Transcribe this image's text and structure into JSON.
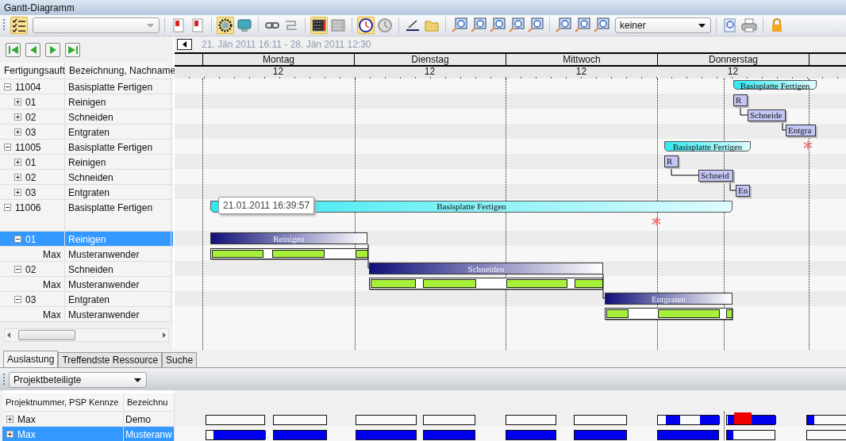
{
  "window": {
    "title": "Gantt-Diagramm"
  },
  "toolbar": [
    [
      {
        "kind": "button",
        "pressed": true
      },
      {
        "kind": "combo"
      }
    ],
    [
      {
        "kind": "button",
        "pressed": false
      },
      {
        "kind": "button",
        "pressed": false
      }
    ],
    [
      {
        "kind": "button",
        "pressed": true
      },
      {
        "kind": "button",
        "pressed": false
      }
    ],
    [
      {
        "kind": "button",
        "pressed": false
      },
      {
        "kind": "button",
        "pressed": false
      }
    ],
    [
      {
        "kind": "button",
        "pressed": true
      },
      {
        "kind": "button",
        "pressed": false
      }
    ],
    [
      {
        "kind": "button",
        "pressed": true
      },
      {
        "kind": "button",
        "pressed": false
      }
    ],
    [
      {
        "kind": "button",
        "pressed": false
      },
      {
        "kind": "button",
        "pressed": false
      }
    ],
    [
      {
        "kind": "button",
        "pressed": false
      },
      {
        "kind": "button",
        "pressed": false
      },
      {
        "kind": "button",
        "pressed": false
      },
      {
        "kind": "button",
        "pressed": false
      },
      {
        "kind": "button",
        "pressed": false
      }
    ],
    [
      {
        "kind": "button",
        "pressed": false
      },
      {
        "kind": "button",
        "pressed": false
      },
      {
        "kind": "button",
        "pressed": false
      },
      {
        "kind": "combo",
        "value": "keiner"
      }
    ],
    [
      {
        "kind": "button",
        "pressed": false
      },
      {
        "kind": "button",
        "pressed": false
      }
    ],
    [
      {
        "kind": "button",
        "pressed": false
      }
    ]
  ],
  "tree": {
    "columns": [
      "Fertigungsauft",
      "Bezeichnung, Nachname"
    ]
  },
  "orders": [
    {
      "id": "11004",
      "name": "Basisplatte Fertigen",
      "expanded": true,
      "selected": false,
      "children": [
        {
          "id": "01",
          "name": "Reinigen",
          "expanded": false,
          "selected": false
        },
        {
          "id": "02",
          "name": "Schneiden",
          "expanded": false,
          "selected": false
        },
        {
          "id": "03",
          "name": "Entgraten",
          "expanded": false,
          "selected": false
        }
      ]
    },
    {
      "id": "11005",
      "name": "Basisplatte Fertigen",
      "expanded": true,
      "selected": false,
      "children": [
        {
          "id": "01",
          "name": "Reinigen",
          "expanded": false,
          "selected": false
        },
        {
          "id": "02",
          "name": "Schneiden",
          "expanded": false,
          "selected": false
        },
        {
          "id": "03",
          "name": "Entgraten",
          "expanded": false,
          "selected": false
        }
      ]
    },
    {
      "id": "11006",
      "name": "Basisplatte Fertigen",
      "expanded": true,
      "selected": false,
      "children": [
        {
          "id": "01",
          "name": "Reinigen",
          "expanded": true,
          "selected": true,
          "children": [
            {
              "id": "Max",
              "name": "Musteranwender",
              "selected": false
            }
          ]
        },
        {
          "id": "02",
          "name": "Schneiden",
          "expanded": true,
          "selected": false,
          "children": [
            {
              "id": "Max",
              "name": "Musteranwender",
              "selected": false
            }
          ]
        },
        {
          "id": "03",
          "name": "Entgraten",
          "expanded": true,
          "selected": false,
          "children": [
            {
              "id": "Max",
              "name": "Musteranwender",
              "selected": false
            }
          ]
        }
      ]
    }
  ],
  "gantt": {
    "date_range": "21. Jän 2011 16:11 - 28. Jän 2011 12:30",
    "days": [
      "Montag",
      "Dienstag",
      "Mittwoch",
      "Donnerstag"
    ],
    "hour_labels": [
      "12",
      "12",
      "12",
      "12"
    ],
    "tooltip": "21.01.2011 16:39:57",
    "bars": [
      {
        "kind": "summary",
        "label": "Basisplatte Fertigen"
      },
      {
        "kind": "task",
        "label": "R"
      },
      {
        "kind": "task",
        "label": "Schneide"
      },
      {
        "kind": "task",
        "label": "Entgra"
      },
      {
        "kind": "summary",
        "label": "Basisplatte Fertigen"
      },
      {
        "kind": "task",
        "label": "R"
      },
      {
        "kind": "task",
        "label": "Schneid"
      },
      {
        "kind": "task",
        "label": "En"
      },
      {
        "kind": "summary",
        "label": "Basisplatte Fertigen"
      },
      {
        "kind": "process",
        "label": "Reinigen"
      },
      {
        "kind": "load"
      },
      {
        "kind": "process",
        "label": "Schneiden"
      },
      {
        "kind": "load"
      },
      {
        "kind": "process",
        "label": "Entgraten"
      },
      {
        "kind": "load"
      }
    ]
  },
  "bottom": {
    "tabs": [
      {
        "label": "Auslastung",
        "selected": true
      },
      {
        "label": "Treffendste Ressource",
        "selected": false
      },
      {
        "label": "Suche",
        "selected": false
      }
    ],
    "filter": "Projektbeteiligte",
    "columns": [
      "Projektnummer, PSP Kennze",
      "Bezeichnu"
    ],
    "rows": [
      {
        "expanded": false,
        "selected": false,
        "cells": [
          "Max",
          "Demo"
        ]
      },
      {
        "expanded": false,
        "selected": true,
        "cells": [
          "Max",
          "Musteranw"
        ]
      }
    ]
  }
}
